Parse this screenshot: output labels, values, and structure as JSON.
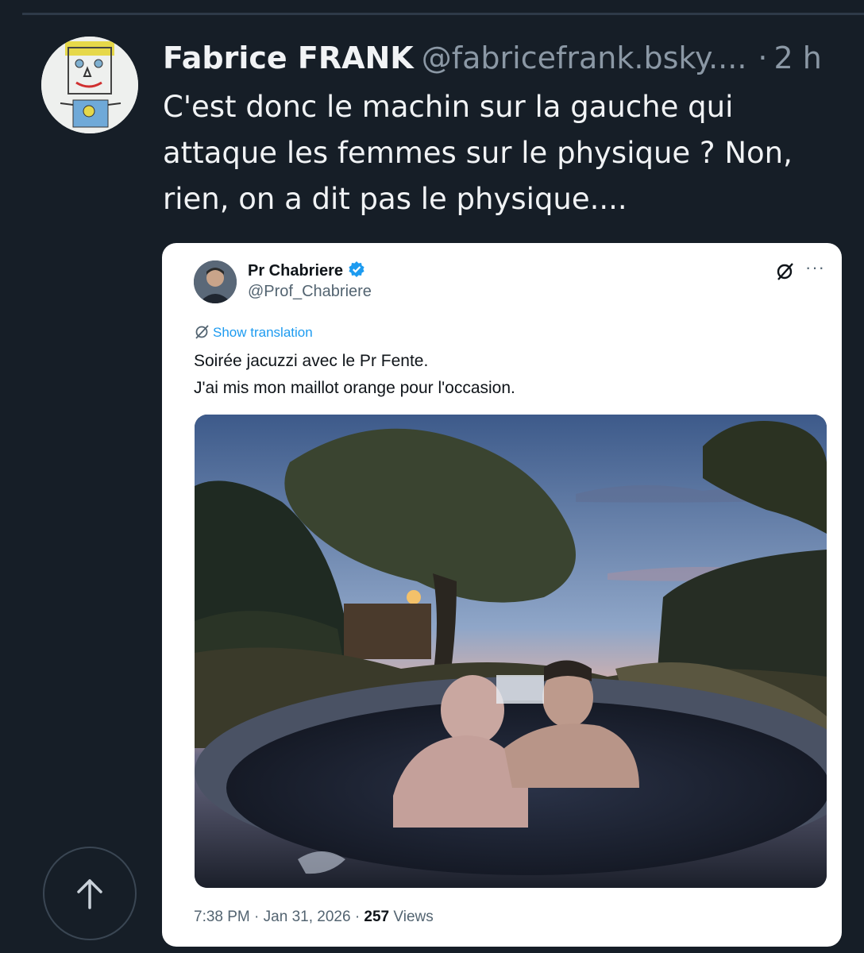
{
  "post": {
    "author_name": "Fabrice FRANK",
    "author_handle": "@fabricefrank.bsky....",
    "separator": "·",
    "time": "2 h",
    "text_lines": [
      "C'est donc le machin sur la gauche qui",
      "attaque les femmes sur le physique ? Non,",
      "rien, on a dit pas le physique...."
    ]
  },
  "embed": {
    "name": "Pr Chabriere",
    "handle": "@Prof_Chabriere",
    "show_translation": "Show translation",
    "text_lines": [
      "Soirée jacuzzi avec le Pr Fente.",
      "J'ai mis mon maillot orange pour l'occasion."
    ],
    "meta": {
      "time": "7:38 PM",
      "dot1": "·",
      "date": "Jan 31, 2026",
      "dot2": "·",
      "views_count": "257",
      "views_label": "Views"
    },
    "more": "···"
  },
  "icons": {
    "verified": "verified-badge-icon",
    "grok": "grok-icon",
    "more": "more-icon",
    "translate": "translate-icon",
    "scroll_top": "arrow-up-icon"
  },
  "colors": {
    "background": "#161e27",
    "link_blue": "#1d9bf0",
    "muted": "#8b98a5"
  }
}
